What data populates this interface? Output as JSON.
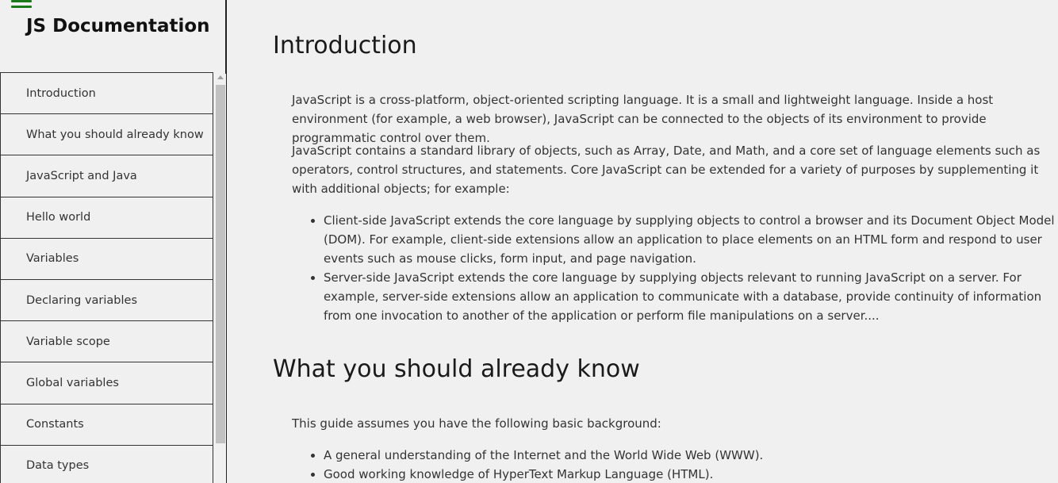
{
  "sidebar": {
    "title": "JS Documentation",
    "items": [
      {
        "label": "Introduction"
      },
      {
        "label": "What you should already know"
      },
      {
        "label": "JavaScript and Java"
      },
      {
        "label": "Hello world"
      },
      {
        "label": "Variables"
      },
      {
        "label": "Declaring variables"
      },
      {
        "label": "Variable scope"
      },
      {
        "label": "Global variables"
      },
      {
        "label": "Constants"
      },
      {
        "label": "Data types"
      }
    ]
  },
  "icons": {
    "menu": "hamburger-menu-icon",
    "menu_color": "#1a7a1a"
  },
  "main": {
    "sections": [
      {
        "title": "Introduction",
        "paragraphs": [
          "JavaScript is a cross-platform, object-oriented scripting language. It is a small and lightweight language. Inside a host environment (for example, a web browser), JavaScript can be connected to the objects of its environment to provide programmatic control over them.",
          "JavaScript contains a standard library of objects, such as Array, Date, and Math, and a core set of language elements such as operators, control structures, and statements. Core JavaScript can be extended for a variety of purposes by supplementing it with additional objects; for example:"
        ],
        "bullets": [
          "Client-side JavaScript extends the core language by supplying objects to control a browser and its Document Object Model (DOM). For example, client-side extensions allow an application to place elements on an HTML form and respond to user events such as mouse clicks, form input, and page navigation.",
          "Server-side JavaScript extends the core language by supplying objects relevant to running JavaScript on a server. For example, server-side extensions allow an application to communicate with a database, provide continuity of information from one invocation to another of the application or perform file manipulations on a server...."
        ]
      },
      {
        "title": "What you should already know",
        "paragraphs": [
          "This guide assumes you have the following basic background:"
        ],
        "bullets": [
          "A general understanding of the Internet and the World Wide Web (WWW).",
          "Good working knowledge of HyperText Markup Language (HTML)."
        ]
      }
    ]
  }
}
